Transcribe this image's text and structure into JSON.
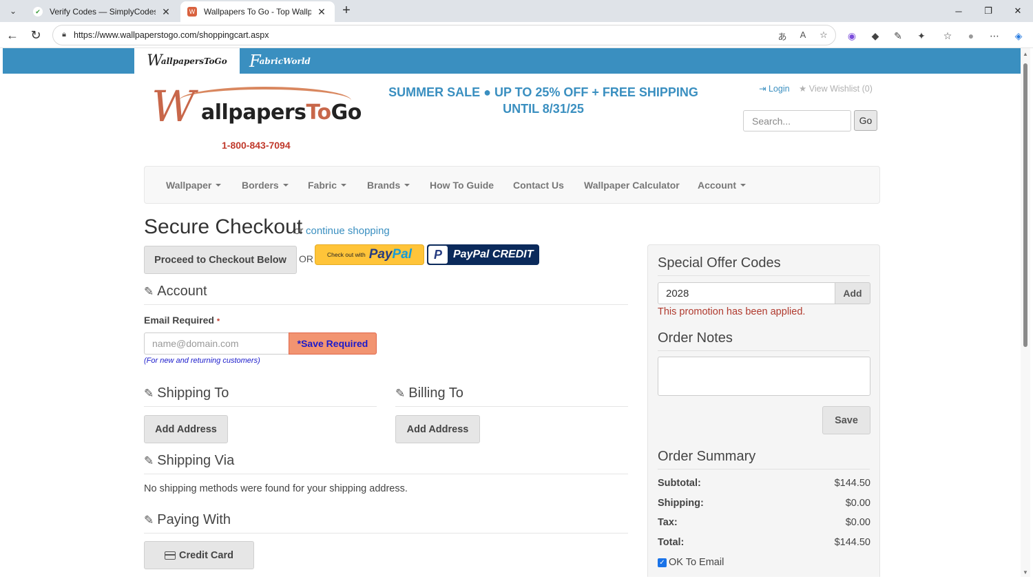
{
  "browser": {
    "tabs": [
      {
        "title": "Verify Codes — SimplyCodes"
      },
      {
        "title": "Wallpapers To Go - Top Wallpaper"
      }
    ],
    "new_tab": "+",
    "url": "https://www.wallpaperstogo.com/shoppingcart.aspx",
    "window_controls": {
      "minimize": "─",
      "maximize": "❐",
      "close": "✕"
    },
    "tab_close": "✕"
  },
  "site": {
    "brand_tabs": [
      {
        "initial": "W",
        "rest": "allpapersToGo"
      },
      {
        "initial": "F",
        "rest": "abricWorld"
      }
    ],
    "logo": {
      "initial": "W",
      "word1": "allpapers",
      "word2": "To",
      "word3": "Go"
    },
    "phone": "1-800-843-7094",
    "promo_line1": "SUMMER SALE ● UP TO 25% OFF + FREE SHIPPING",
    "promo_line2": "UNTIL 8/31/25",
    "login": "Login",
    "wishlist": "View Wishlist (0)",
    "search": {
      "placeholder": "Search...",
      "go": "Go"
    }
  },
  "nav": {
    "items": [
      {
        "label": "Wallpaper",
        "dropdown": true
      },
      {
        "label": "Borders",
        "dropdown": true
      },
      {
        "label": "Fabric",
        "dropdown": true
      },
      {
        "label": "Brands",
        "dropdown": true
      },
      {
        "label": "How To Guide",
        "dropdown": false
      },
      {
        "label": "Contact Us",
        "dropdown": false
      },
      {
        "label": "Wallpaper Calculator",
        "dropdown": false
      },
      {
        "label": "Account",
        "dropdown": true
      }
    ]
  },
  "checkout": {
    "title": "Secure Checkout",
    "or": "or",
    "continue": "continue shopping",
    "proceed": "Proceed to Checkout Below",
    "or_caps": "OR",
    "paypal_small": "Check out with",
    "paypal_pay": "Pay",
    "paypal_pal": "Pal",
    "paypal_credit": "PayPal CREDIT",
    "paypal_p": "P",
    "account": {
      "heading": "Account",
      "email_label": "Email Required",
      "required_mark": "*",
      "email_placeholder": "name@domain.com",
      "save_required": "*Save Required",
      "hint": "(For new and returning customers)"
    },
    "shipping_to": {
      "heading": "Shipping To",
      "button": "Add Address"
    },
    "billing_to": {
      "heading": "Billing To",
      "button": "Add Address"
    },
    "shipping_via": {
      "heading": "Shipping Via",
      "message": "No shipping methods were found for your shipping address."
    },
    "paying_with": {
      "heading": "Paying With",
      "button": "Credit Card"
    }
  },
  "sidebar": {
    "offer_heading": "Special Offer Codes",
    "code_value": "2028",
    "add": "Add",
    "promo_applied": "This promotion has been applied.",
    "notes_heading": "Order Notes",
    "save": "Save",
    "summary_heading": "Order Summary",
    "summary": [
      {
        "label": "Subtotal:",
        "value": "$144.50"
      },
      {
        "label": "Shipping:",
        "value": "$0.00"
      },
      {
        "label": "Tax:",
        "value": "$0.00"
      },
      {
        "label": "Total:",
        "value": "$144.50"
      }
    ],
    "ok_to_email": "OK To Email",
    "ok_to_email_checked": true
  },
  "colors": {
    "accent": "#3a8fc0",
    "brand": "#c8674a",
    "error": "#b03a2e",
    "save_required_bg": "#f29471"
  }
}
